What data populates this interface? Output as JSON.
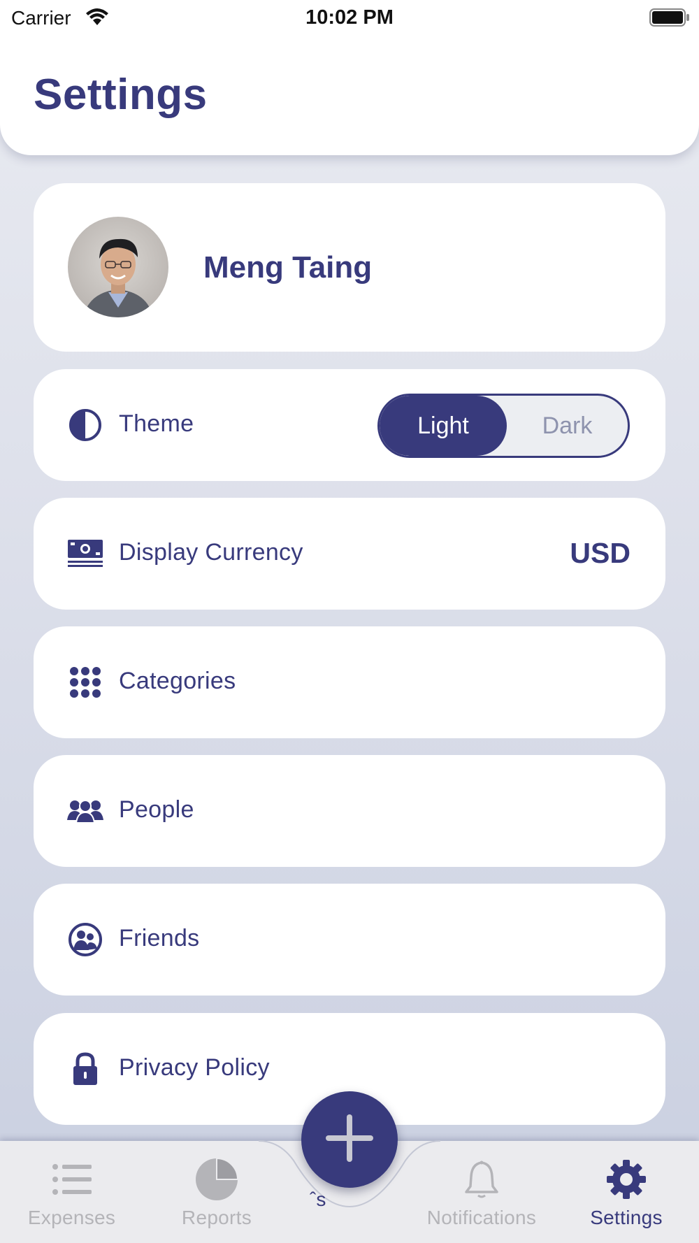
{
  "status_bar": {
    "carrier": "Carrier",
    "time": "10:02 PM"
  },
  "header": {
    "title": "Settings"
  },
  "profile": {
    "name": "Meng Taing"
  },
  "settings": {
    "theme": {
      "label": "Theme",
      "icon": "half-circle-icon",
      "options": [
        "Light",
        "Dark"
      ],
      "selected": "Light"
    },
    "currency": {
      "label": "Display Currency",
      "icon": "money-icon",
      "value": "USD"
    },
    "categories": {
      "label": "Categories",
      "icon": "grid-dots-icon"
    },
    "people": {
      "label": "People",
      "icon": "people-icon"
    },
    "friends": {
      "label": "Friends",
      "icon": "friends-icon"
    },
    "privacy": {
      "label": "Privacy Policy",
      "icon": "lock-icon"
    }
  },
  "tab_bar": {
    "tabs": [
      {
        "label": "Expenses",
        "icon": "list-icon",
        "active": false
      },
      {
        "label": "Reports",
        "icon": "pie-chart-icon",
        "active": false
      },
      {
        "label": "Notifications",
        "icon": "bell-icon",
        "active": false
      },
      {
        "label": "Settings",
        "icon": "gear-icon",
        "active": true
      }
    ],
    "fab_icon": "plus-icon",
    "fab_partial_label": "ˆs"
  },
  "colors": {
    "accent": "#383a7c",
    "inactive_tab": "#b4b4b8",
    "background": "#e3e6ee",
    "card": "#ffffff"
  }
}
